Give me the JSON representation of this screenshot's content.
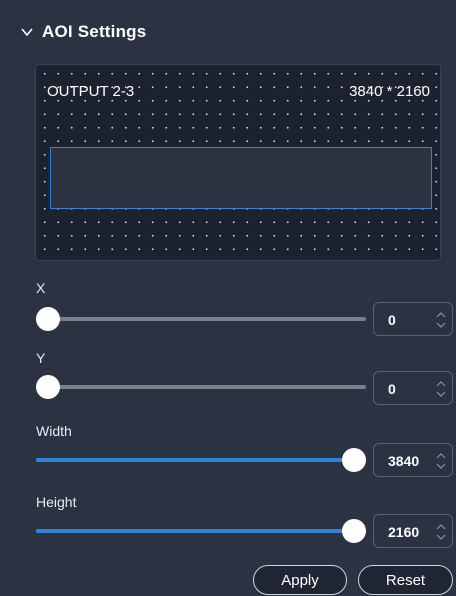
{
  "header": {
    "title": "AOI Settings"
  },
  "preview": {
    "output_name": "OUTPUT 2-3",
    "resolution": "3840 * 2160"
  },
  "params": [
    {
      "label": "X",
      "value": "0",
      "fraction": 0.0
    },
    {
      "label": "Y",
      "value": "0",
      "fraction": 0.0
    },
    {
      "label": "Width",
      "value": "3840",
      "fraction": 1.0
    },
    {
      "label": "Height",
      "value": "2160",
      "fraction": 1.0
    }
  ],
  "buttons": {
    "apply": "Apply",
    "reset": "Reset"
  },
  "colors": {
    "accent": "#2f86d8",
    "background": "#2b3241"
  },
  "icons": {
    "collapse": "chevron-down-icon",
    "stepper": "spin-arrows-icon"
  }
}
